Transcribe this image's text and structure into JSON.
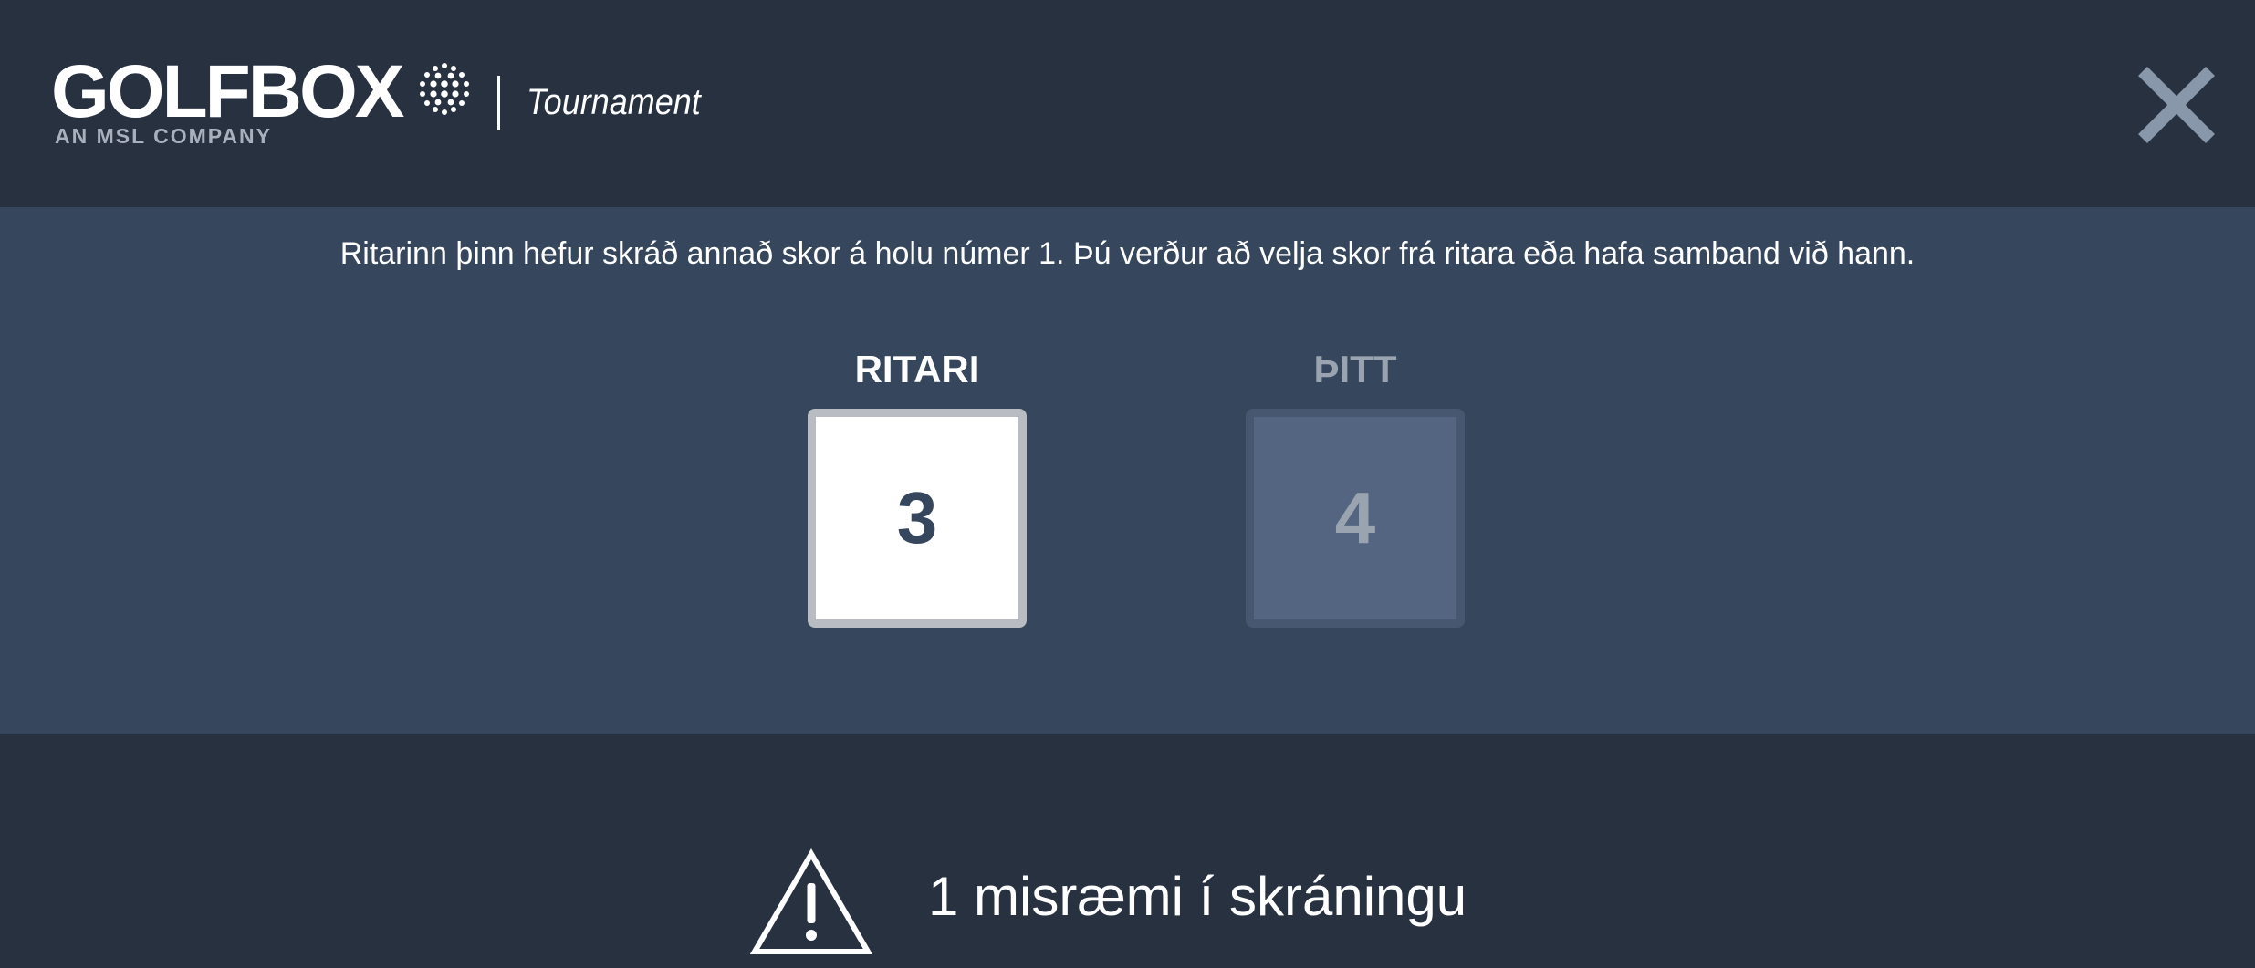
{
  "header": {
    "logo": "GOLFBOX",
    "logo_subtitle": "AN MSL COMPANY",
    "product_name": "Tournament",
    "close_icon": "close-icon"
  },
  "conflict": {
    "message": "Ritarinn þinn hefur skráð annað skor á holu númer 1. Þú verður að velja skor frá ritara eða hafa samband við hann.",
    "options": [
      {
        "label": "RITARI",
        "score": "3",
        "selected": true
      },
      {
        "label": "ÞITT",
        "score": "4",
        "selected": false
      }
    ]
  },
  "warning": {
    "icon": "warning-icon",
    "text": "1 misræmi í skráningu"
  },
  "colors": {
    "header_bg": "#283140",
    "panel_bg": "#36475d",
    "close_icon": "#8997ab",
    "selected_box_bg": "#ffffff",
    "unselected_box_bg": "#536580"
  }
}
